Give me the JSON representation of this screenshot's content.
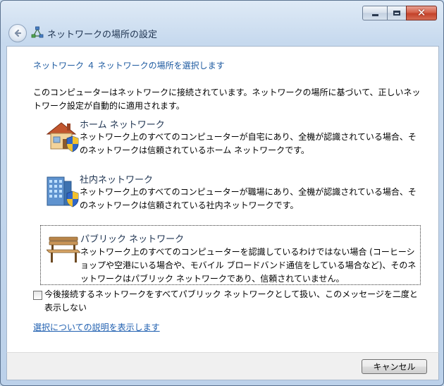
{
  "window": {
    "title": "ネットワークの場所の設定",
    "caption_buttons": [
      "minimize-icon",
      "maximize-icon",
      "close-icon"
    ]
  },
  "main_instruction": "ネットワーク ４ ネットワークの場所を選択します",
  "intro_text": "このコンピューターはネットワークに接続されています。ネットワークの場所に基づいて、正しいネットワーク設定が自動的に適用されます。",
  "options": [
    {
      "icon": "home-network-icon",
      "title": "ホーム ネットワーク",
      "description": "ネットワーク上のすべてのコンピューターが自宅にあり、全機が認識されている場合、そのネットワークは信頼されているホーム ネットワークです。"
    },
    {
      "icon": "work-network-icon",
      "title": "社内ネットワーク",
      "description": "ネットワーク上のすべてのコンピューターが職場にあり、全機が認識されている場合、そのネットワークは信頼されている社内ネットワークです。"
    },
    {
      "icon": "public-network-icon",
      "title": "パブリック ネットワーク",
      "description": "ネットワーク上のすべてのコンピューターを認識しているわけではない場合 (コーヒーショップや空港にいる場合や、モバイル ブロードバンド通信をしている場合など)、そのネットワークはパブリック ネットワークであり、信頼されていません。"
    }
  ],
  "checkbox": {
    "label": "今後接続するネットワークをすべてパブリック ネットワークとして扱い、このメッセージを二度と表示しない",
    "checked": false
  },
  "help_link": "選択についての説明を表示します",
  "footer": {
    "cancel_label": "キャンセル"
  }
}
